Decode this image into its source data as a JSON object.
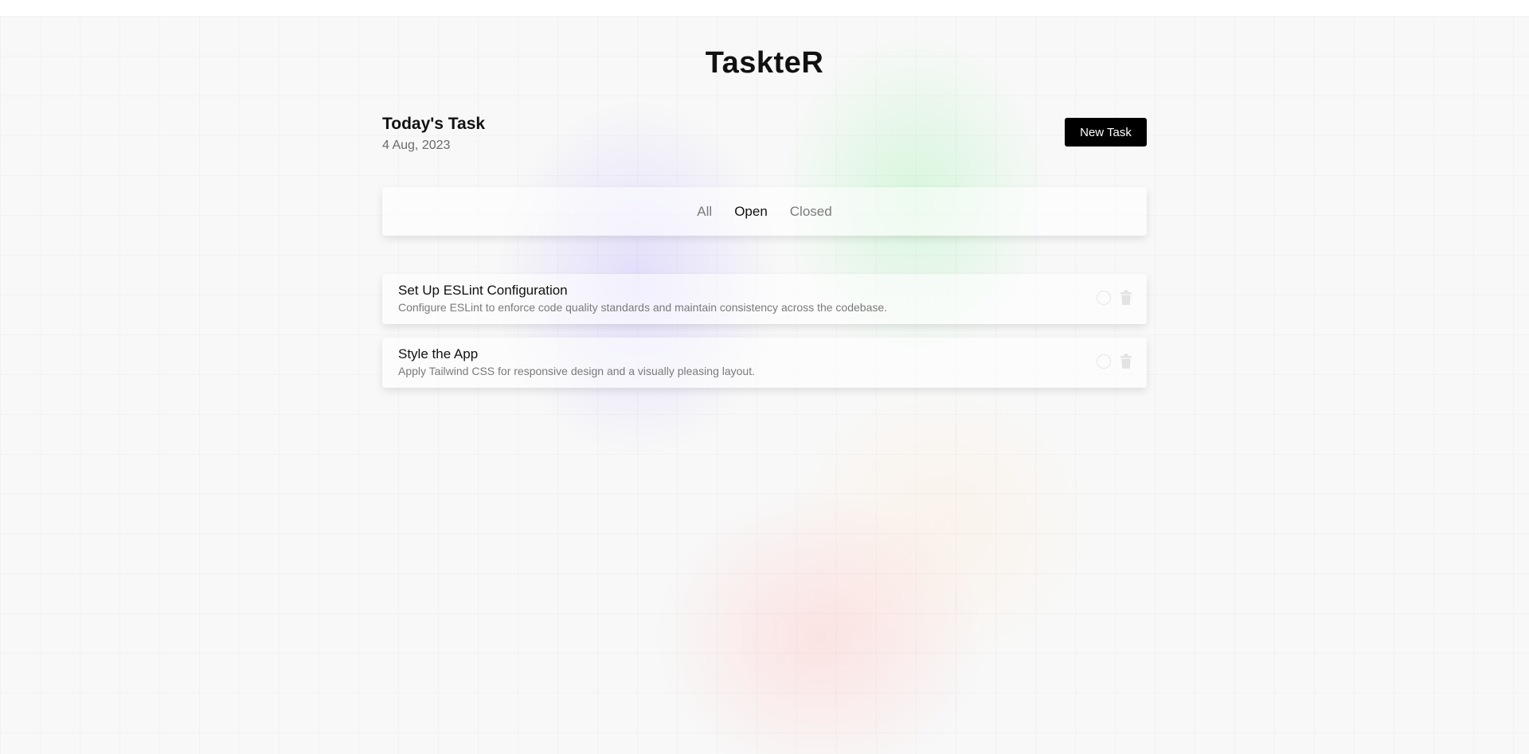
{
  "app": {
    "title": "TaskteR"
  },
  "header": {
    "title": "Today's Task",
    "date": "4 Aug, 2023",
    "new_task_label": "New Task"
  },
  "filters": {
    "tabs": [
      {
        "label": "All",
        "active": false
      },
      {
        "label": "Open",
        "active": true
      },
      {
        "label": "Closed",
        "active": false
      }
    ]
  },
  "tasks": [
    {
      "title": "Set Up ESLint Configuration",
      "description": "Configure ESLint to enforce code quality standards and maintain consistency across the codebase.",
      "completed": false
    },
    {
      "title": "Style the App",
      "description": "Apply Tailwind CSS for responsive design and a visually pleasing layout.",
      "completed": false
    }
  ],
  "icons": {
    "complete": "circle-icon",
    "delete": "trash-icon"
  },
  "colors": {
    "accent": "#000000",
    "muted_text": "#7a7a7a",
    "icon": "#e3e3e3"
  }
}
